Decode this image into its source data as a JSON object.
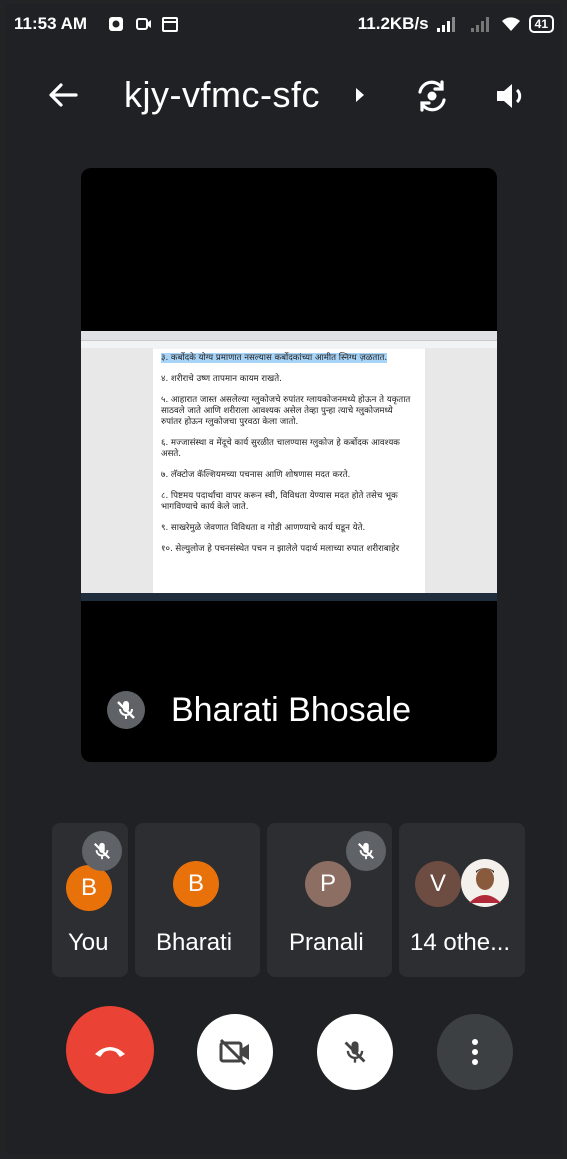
{
  "status_bar": {
    "time": "11:53 AM",
    "net_speed": "11.2KB/s",
    "battery": "41"
  },
  "top_bar": {
    "meeting_code": "kjy-vfmc-sfc"
  },
  "main_tile": {
    "speaker_name": "Bharati Bhosale",
    "shared_doc_lines": [
      "३. कर्बोदके योग्य प्रमाणात नसल्यास कर्बोदकांच्या आमीत स्निग्ध ज़ळतात.",
      "४. शरीराचे उष्ण तापमान कायम राखते.",
      "५. आहारात जास्त असलेल्या ग्लुकोजचे रुपांतर ग्लायकोजनमध्ये होऊन ते यकृतात साठवले जाते आणि शरीराला आवश्यक असेल तेव्हा पुन्हा त्याचे ग्लुकोजमध्ये रुपांतर होऊन ग्लुकोजचा पुरवठा केला जातो.",
      "६. मज्जासंस्था व मेंदूचे कार्य सुरळीत चालण्यास ग्लुकोज हे कर्बोदक आवश्यक असते.",
      "७. लॅक्टोज कॅल्शियमच्या पचनास आणि शोषणास मदत करते.",
      "८. पिष्टमय पदार्थांचा वापर करून स्वी, विविधता येण्यास मदत होते तसेच भूक भागविण्याचे कार्य केले जाते.",
      "९. साखरेमुळे जेवणात विविधता व गोडी आणण्याचे कार्य घडून येते.",
      "१०. सेल्युलोज हे पचनसंस्थेत पचन न झालेले पदार्थ मलाच्या रुपात शरीराबाहेर"
    ]
  },
  "participants": [
    {
      "initial": "B",
      "label": "You",
      "color": "#e8710a",
      "muted": true
    },
    {
      "initial": "B",
      "label": "Bharati",
      "color": "#e8710a",
      "muted": false
    },
    {
      "initial": "P",
      "label": "Pranali",
      "color": "#8d6e63",
      "muted": true
    },
    {
      "initial": "V",
      "label": "14 othe...",
      "color": "#6d4c41",
      "muted": false
    }
  ],
  "controls": {
    "end_call_color": "#ea4335",
    "icons": [
      "end-call-icon",
      "camera-off-icon",
      "mic-off-icon",
      "more-vert-icon"
    ]
  }
}
